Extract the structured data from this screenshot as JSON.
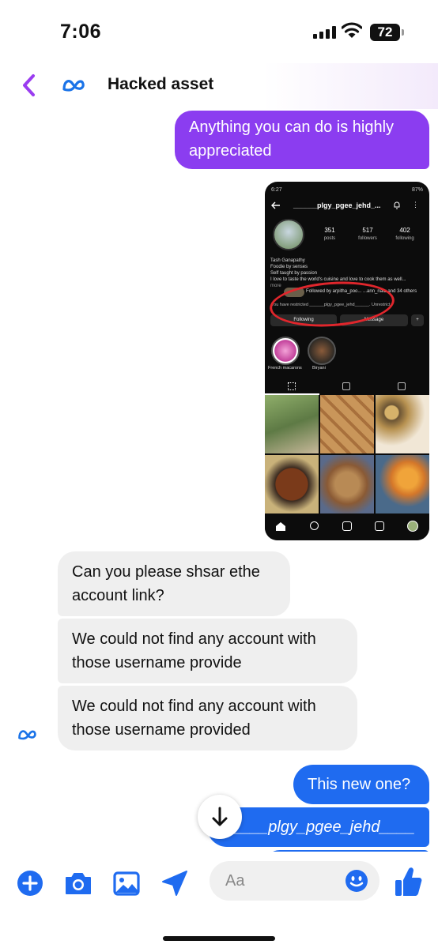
{
  "status_bar": {
    "time": "7:06",
    "battery": "72"
  },
  "header": {
    "title": "Hacked asset",
    "back_icon": "chevron-left-icon",
    "logo_icon": "meta-logo-icon"
  },
  "messages": [
    {
      "id": "m1",
      "side": "sent",
      "text_lines": [
        "Anything you can do is highly",
        "appreciated"
      ]
    },
    {
      "id": "m2",
      "side": "received",
      "text_lines": [
        "Can you please shsar ethe",
        "account link?"
      ]
    },
    {
      "id": "m3",
      "side": "received",
      "text_lines": [
        "We could not find any account with",
        "those username provide"
      ]
    },
    {
      "id": "m4",
      "side": "received",
      "text_lines": [
        "We could not find any account with",
        "those username provided"
      ]
    },
    {
      "id": "m5",
      "side": "sent",
      "text": "This new one?"
    },
    {
      "id": "m6",
      "side": "sent",
      "text": "____plgy_pgee_jehd____"
    }
  ],
  "screenshot": {
    "time": "6:27",
    "battery": "87%",
    "username": "______plgy_pgee_jehd_...",
    "stats": [
      {
        "value": "351",
        "label": "posts"
      },
      {
        "value": "517",
        "label": "followers"
      },
      {
        "value": "402",
        "label": "following"
      }
    ],
    "bio": [
      "Tash Ganapathy",
      "Foodie by senses",
      "Self taught by passion",
      "I love to taste the world's cuisine and love to cook them as well...",
      "more"
    ],
    "followed_by": "Followed by arpitha_poo... ...ann_natz and 34 others",
    "restricted_text": "You have restricted ______plgy_pgee_jehd______. Unrestrict",
    "following_btn": "Following",
    "message_btn": "Message",
    "highlights": [
      "French macarons",
      "Biryani"
    ]
  },
  "composer": {
    "placeholder": "Aa"
  },
  "colors": {
    "purple_bubble": "#8b3df0",
    "blue_bubble": "#1f6bf0",
    "received_bubble": "#efefef",
    "accent": "#1f6bf0"
  }
}
